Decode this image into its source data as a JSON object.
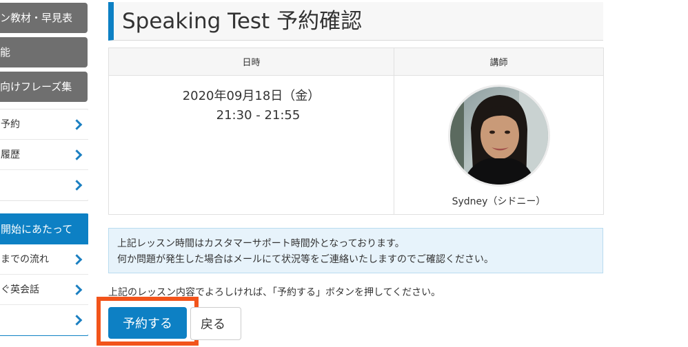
{
  "sidebar": {
    "gray_buttons": [
      {
        "label": "ン教材・早見表"
      },
      {
        "label": "能"
      },
      {
        "label": "向けフレーズ集"
      }
    ],
    "menu1": [
      {
        "label": "予約"
      },
      {
        "label": "履歴"
      },
      {
        "label": ""
      }
    ],
    "section2": {
      "header": "開始にあたって",
      "items": [
        {
          "label": "までの流れ"
        },
        {
          "label": "ぐ英会話"
        },
        {
          "label": ""
        }
      ]
    }
  },
  "main": {
    "title": "Speaking Test 予約確認",
    "table": {
      "col_datetime": "日時",
      "col_teacher": "講師",
      "date": "2020年09月18日（金）",
      "time": "21:30 - 21:55",
      "teacher_name": "Sydney（シドニー）"
    },
    "notice": {
      "line1": "上記レッスン時間はカスタマーサポート時間外となっております。",
      "line2": "何か問題が発生した場合はメールにて状況等をご連絡いたしますのでご確認ください。"
    },
    "instruction": "上記のレッスン内容でよろしければ、「予約する」ボタンを押してください。",
    "reserve_label": "予約する",
    "back_label": "戻る"
  },
  "colors": {
    "accent": "#0d80c4",
    "highlight": "#f2541b",
    "gray_button": "#6f6f6f",
    "notice_bg": "#e7f3fb"
  },
  "icons": {
    "chevron": "chevron-right-icon"
  }
}
